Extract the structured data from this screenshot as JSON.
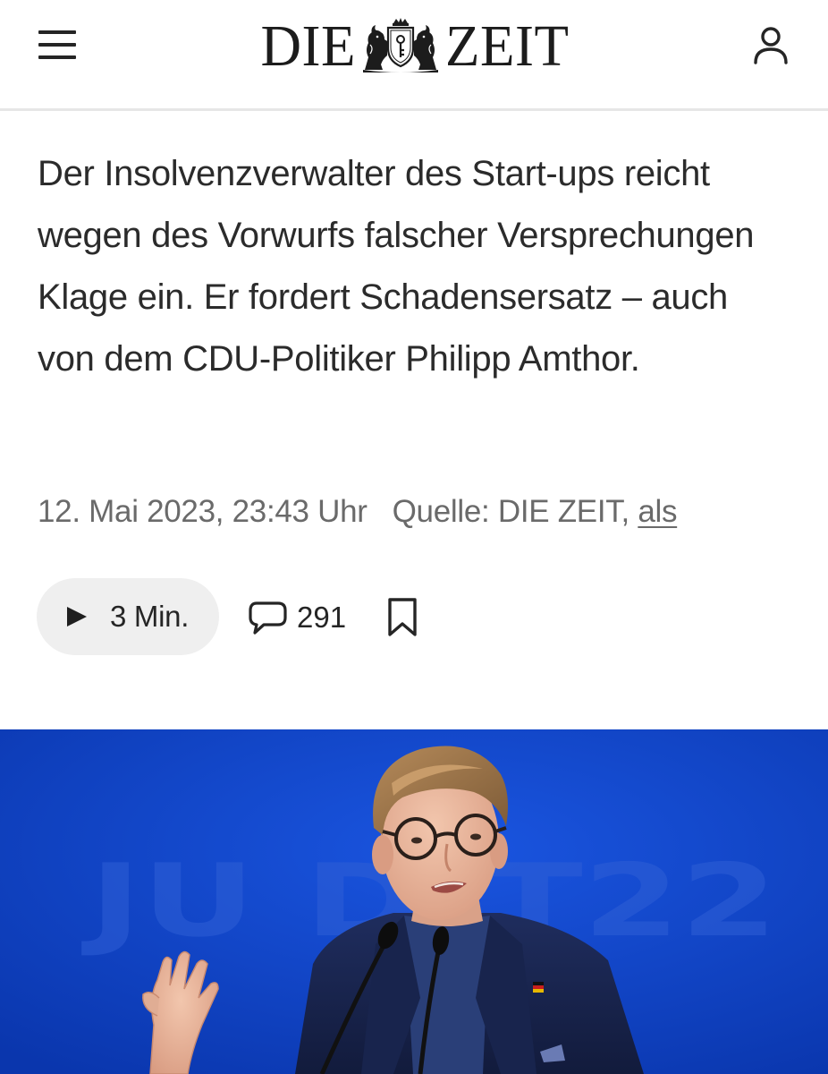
{
  "header": {
    "logo_left": "DIE",
    "logo_right": "ZEIT",
    "icons": {
      "menu": "hamburger-menu-icon",
      "user": "user-account-icon",
      "crest": "coat-of-arms-crest"
    }
  },
  "article": {
    "summary": "Der Insolvenzverwalter des Start-ups reicht wegen des Vorwurfs falscher Versprechungen Klage ein. Er fordert Schadensersatz – auch von dem CDU-Politiker Philipp Amthor.",
    "date": "12. Mai 2023, 23:43 Uhr",
    "source_prefix": "Quelle: DIE ZEIT,",
    "author": "als"
  },
  "actions": {
    "listen_label": "3 Min.",
    "comment_count": "291",
    "icons": {
      "play": "play-icon",
      "comment": "speech-bubble-icon",
      "bookmark": "bookmark-icon"
    }
  },
  "photo": {
    "backdrop_text": "JU DLT22",
    "colors": {
      "background": "#0b3fc0",
      "backdrop_text": "#2f5fd6"
    }
  },
  "colors": {
    "text": "#252525",
    "meta": "#6a6a6a",
    "divider": "#e6e6e6",
    "listen_button_bg": "#efefef"
  }
}
